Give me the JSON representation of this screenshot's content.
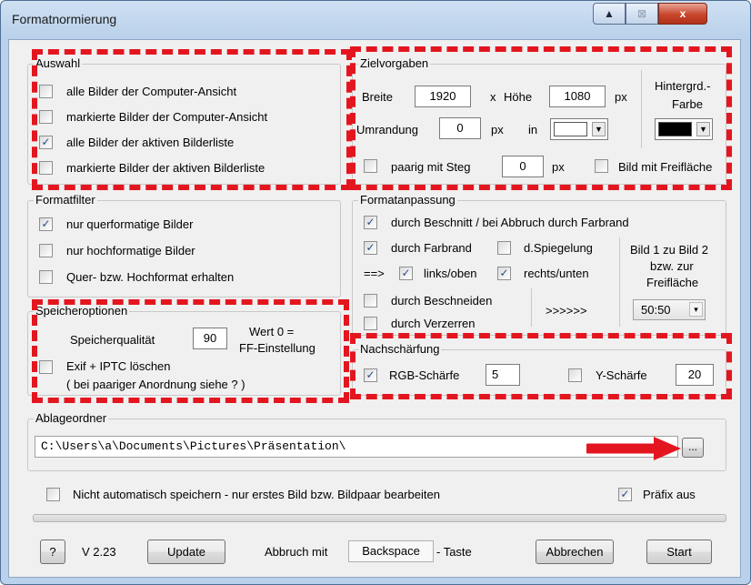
{
  "window": {
    "title": "Formatnormierung",
    "caption_buttons": {
      "up_label": "▲",
      "pin_label": "⊠",
      "close_label": "x"
    }
  },
  "auswahl": {
    "legend": "Auswahl",
    "items": [
      {
        "label": "alle Bilder der Computer-Ansicht",
        "checked": false
      },
      {
        "label": "markierte Bilder der Computer-Ansicht",
        "checked": false
      },
      {
        "label": "alle Bilder der aktiven Bilderliste",
        "checked": true
      },
      {
        "label": "markierte Bilder der aktiven Bilderliste",
        "checked": false
      }
    ]
  },
  "zielvorgaben": {
    "legend": "Zielvorgaben",
    "breite_label": "Breite",
    "breite_value": "1920",
    "x_label": "x",
    "hoehe_label": "Höhe",
    "hoehe_value": "1080",
    "px_label": "px",
    "umrandung_label": "Umrandung",
    "umrandung_value": "0",
    "umrandung_px": "px",
    "in_label": "in",
    "umrandung_color": "#ffffff",
    "hintergrund_label_1": "Hintergrd.-",
    "hintergrund_label_2": "Farbe",
    "hintergrund_color": "#000000",
    "paarig_label": "paarig mit Steg",
    "paarig_checked": false,
    "steg_value": "0",
    "steg_px": "px",
    "freiflaeche_label": "Bild mit Freifläche",
    "freiflaeche_checked": false
  },
  "formatfilter": {
    "legend": "Formatfilter",
    "items": [
      {
        "label": "nur querformatige Bilder",
        "checked": true
      },
      {
        "label": "nur hochformatige Bilder",
        "checked": false
      },
      {
        "label": "Quer- bzw. Hochformat erhalten",
        "checked": false
      }
    ]
  },
  "formatanpassung": {
    "legend": "Formatanpassung",
    "beschnitt_label": "durch Beschnitt / bei Abbruch durch Farbrand",
    "beschnitt_checked": true,
    "farbrand_label": "durch Farbrand",
    "farbrand_checked": true,
    "spiegelung_label": "d.Spiegelung",
    "spiegelung_checked": false,
    "arrow_label": "==>",
    "links_oben_label": "links/oben",
    "links_oben_checked": true,
    "rechts_unten_label": "rechts/unten",
    "rechts_unten_checked": true,
    "beschneiden_label": "durch Beschneiden",
    "beschneiden_checked": false,
    "verzerren_label": "durch Verzerren",
    "verzerren_checked": false,
    "chevrons_label": ">>>>>>",
    "bild_label_1": "Bild 1 zu Bild 2",
    "bild_label_2": "bzw. zur",
    "bild_label_3": "Freifläche",
    "ratio_value": "50:50"
  },
  "speicheroptionen": {
    "legend": "Speicheroptionen",
    "qualitaet_label": "Speicherqualität",
    "qualitaet_value": "90",
    "wert_label_1": "Wert 0 =",
    "wert_label_2": "FF-Einstellung",
    "exif_label": "Exif + IPTC löschen",
    "exif_checked": false,
    "hinweis_label": "( bei paariger Anordnung siehe ? )"
  },
  "nachschaerfung": {
    "legend": "Nachschärfung",
    "rgb_label": "RGB-Schärfe",
    "rgb_checked": true,
    "rgb_value": "5",
    "y_label": "Y-Schärfe",
    "y_checked": false,
    "y_value": "20"
  },
  "ablageordner": {
    "legend": "Ablageordner",
    "path": "C:\\Users\\a\\Documents\\Pictures\\Präsentation\\",
    "browse_label": "..."
  },
  "options": {
    "nicht_speichern_label": "Nicht automatisch speichern - nur erstes Bild bzw. Bildpaar bearbeiten",
    "nicht_speichern_checked": false,
    "praefix_label": "Präfix aus",
    "praefix_checked": true
  },
  "progress": 0,
  "footer": {
    "help_label": "?",
    "version": "V 2.23",
    "update_label": "Update",
    "abbruch_prefix": "Abbruch mit",
    "backspace_label": "Backspace",
    "abbruch_suffix": "- Taste",
    "abbrechen_label": "Abbrechen",
    "start_label": "Start"
  },
  "colors": {
    "annotation_red": "#e3161f",
    "check_blue": "#2a4a84"
  }
}
